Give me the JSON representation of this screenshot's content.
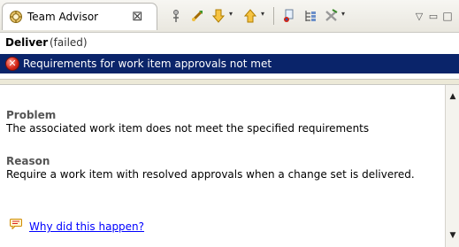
{
  "tab": {
    "title": "Team Advisor",
    "close_glyph": "⊠",
    "icon": "team-advisor-icon"
  },
  "toolbar": {
    "icons": [
      "pin-icon",
      "run-icon",
      "next-icon",
      "previous-icon",
      "settings-icon",
      "tree-icon",
      "remove-all-icon"
    ],
    "dropdown_glyph": "▾",
    "menu_glyph": "▽",
    "minimize_glyph": "▭",
    "maximize_glyph": "□"
  },
  "operation": {
    "name": "Deliver",
    "status": "(failed)"
  },
  "selected_item": {
    "icon": "error-icon",
    "icon_glyph": "✕",
    "text": "Requirements for work item approvals not met"
  },
  "details": {
    "problem_heading": "Problem",
    "problem_text": "The associated work item does not meet the specified requirements",
    "reason_heading": "Reason",
    "reason_text": "Require a work item with resolved approvals when a change set is delivered.",
    "help_link": "Why did this happen?",
    "help_icon": "help-bubble-icon"
  },
  "scrollbar": {
    "up_glyph": "▲",
    "down_glyph": "▼"
  },
  "colors": {
    "selection": "#0a246a",
    "link": "#0000ff",
    "error": "#d42416"
  }
}
